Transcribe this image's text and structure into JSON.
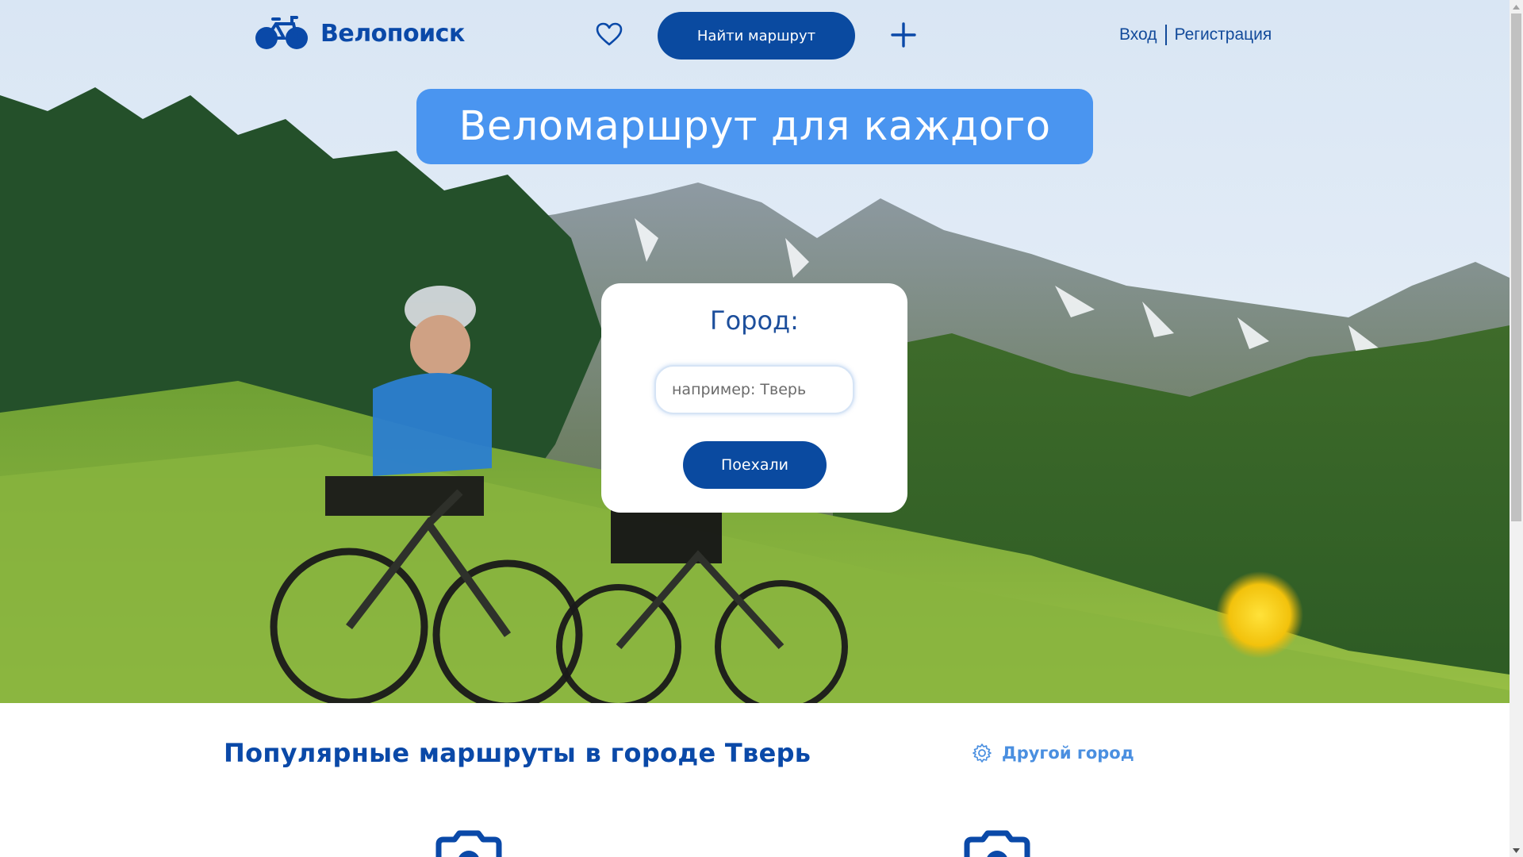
{
  "header": {
    "logo_text": "Велопоиск",
    "find_route_label": "Найти маршрут",
    "login_label": "Вход",
    "register_label": "Регистрация"
  },
  "hero": {
    "banner_title": "Веломаршрут для каждого"
  },
  "city_form": {
    "title": "Город:",
    "input_placeholder": "например: Тверь",
    "input_value": "",
    "submit_label": "Поехали"
  },
  "popular": {
    "title": "Популярные маршруты в городе Тверь",
    "other_city_label": "Другой город"
  },
  "colors": {
    "brand_dark": "#0a4aa0",
    "banner_blue": "#4a95f0",
    "link_blue": "#4a8fe0"
  },
  "icons": [
    "bicycle-logo-icon",
    "heart-icon",
    "plus-icon",
    "gear-icon",
    "camera-icon"
  ]
}
